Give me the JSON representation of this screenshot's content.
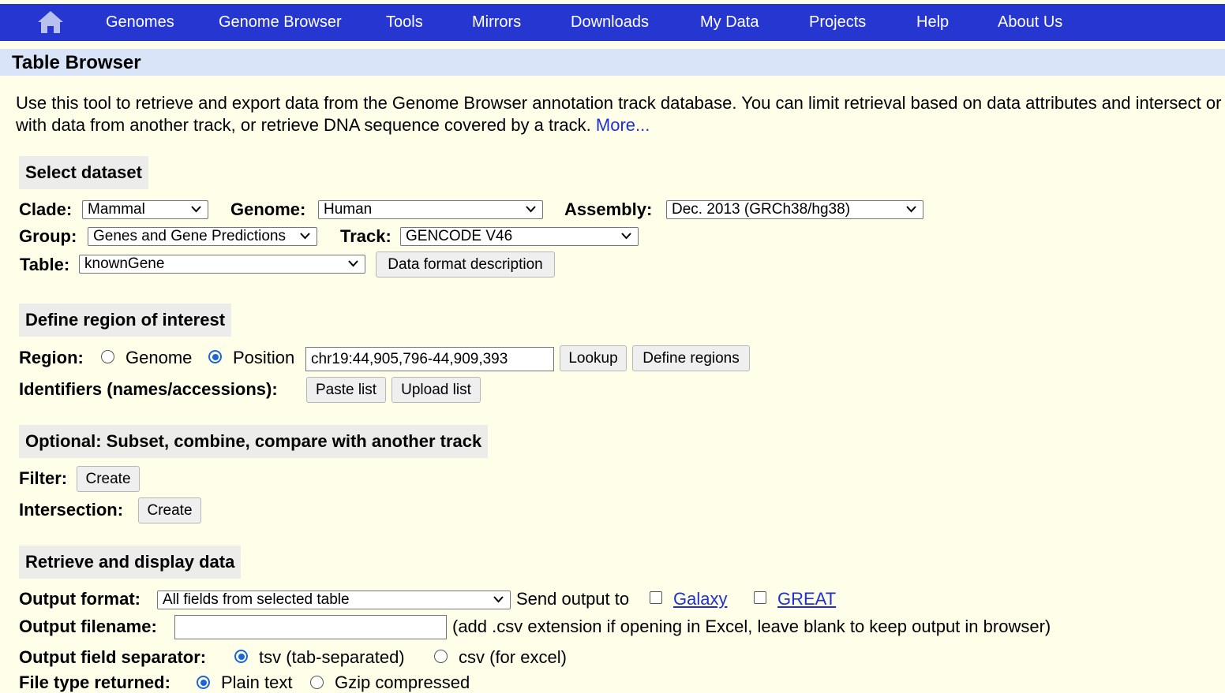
{
  "nav": {
    "items": [
      "Genomes",
      "Genome Browser",
      "Tools",
      "Mirrors",
      "Downloads",
      "My Data",
      "Projects",
      "Help",
      "About Us"
    ]
  },
  "page": {
    "title": "Table Browser",
    "intro_text": "Use this tool to retrieve and export data from the Genome Browser annotation track database. You can limit retrieval based on data attributes and intersect or merge with data from another track, or retrieve DNA sequence covered by a track.",
    "more_link": "More..."
  },
  "select_dataset": {
    "header": "Select dataset",
    "clade_label": "Clade:",
    "clade_value": "Mammal",
    "genome_label": "Genome:",
    "genome_value": "Human",
    "assembly_label": "Assembly:",
    "assembly_value": "Dec. 2013 (GRCh38/hg38)",
    "group_label": "Group:",
    "group_value": "Genes and Gene Predictions",
    "track_label": "Track:",
    "track_value": "GENCODE V46",
    "table_label": "Table:",
    "table_value": "knownGene",
    "data_format_button": "Data format description"
  },
  "region": {
    "header": "Define region of interest",
    "region_label": "Region:",
    "genome_option": "Genome",
    "position_option": "Position",
    "position_value": "chr19:44,905,796-44,909,393",
    "lookup_button": "Lookup",
    "define_regions_button": "Define regions",
    "identifiers_label": "Identifiers (names/accessions):",
    "paste_list_button": "Paste list",
    "upload_list_button": "Upload list"
  },
  "optional": {
    "header": "Optional: Subset, combine, compare with another track",
    "filter_label": "Filter:",
    "filter_button": "Create",
    "intersection_label": "Intersection:",
    "intersection_button": "Create"
  },
  "retrieve": {
    "header": "Retrieve and display data",
    "output_format_label": "Output format:",
    "output_format_value": "All fields from selected table",
    "send_output_text": "Send output to",
    "galaxy_link": "Galaxy",
    "great_link": "GREAT",
    "output_filename_label": "Output filename:",
    "output_filename_value": "",
    "filename_hint": "(add .csv extension if opening in Excel, leave blank to keep output in browser)",
    "separator_label": "Output field separator:",
    "tsv_option": "tsv (tab-separated)",
    "csv_option": "csv (for excel)",
    "file_type_label": "File type returned:",
    "plain_text_option": "Plain text",
    "gzip_option": "Gzip compressed"
  },
  "colors": {
    "navbar": "#2636d1",
    "title_bar": "#d9e4f8",
    "background": "#fffee8",
    "section_header": "#ececea",
    "link": "#1f2fd0",
    "radio_selected": "#1a66d9"
  }
}
